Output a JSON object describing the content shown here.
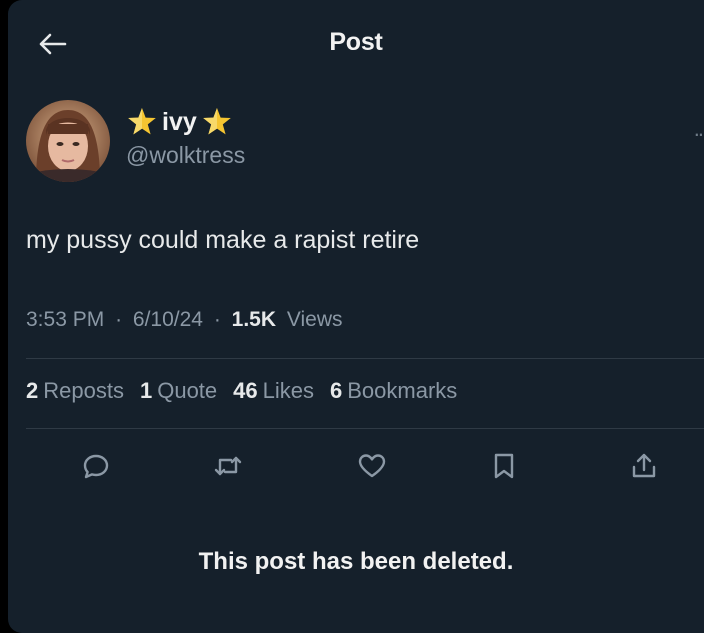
{
  "header": {
    "title": "Post",
    "back_icon": "arrow-left-icon"
  },
  "author": {
    "display_name": "ivy",
    "handle": "@wolktress",
    "name_icons": [
      "star-icon",
      "star-icon"
    ],
    "more_glyph": ".."
  },
  "post": {
    "text": "my pussy could make a rapist retire",
    "time": "3:53 PM",
    "date": "6/10/24",
    "separator": "·",
    "views_count": "1.5K",
    "views_label": "Views"
  },
  "stats": [
    {
      "count": "2",
      "label": "Reposts"
    },
    {
      "count": "1",
      "label": "Quote"
    },
    {
      "count": "46",
      "label": "Likes"
    },
    {
      "count": "6",
      "label": "Bookmarks"
    }
  ],
  "actions": [
    {
      "name": "reply",
      "icon": "reply-icon"
    },
    {
      "name": "repost",
      "icon": "repost-icon"
    },
    {
      "name": "like",
      "icon": "heart-icon"
    },
    {
      "name": "bookmark",
      "icon": "bookmark-icon"
    },
    {
      "name": "share",
      "icon": "share-icon"
    }
  ],
  "notice": "This post has been deleted.",
  "colors": {
    "background": "#15202b",
    "text_primary": "#e7e9ea",
    "text_secondary": "#8b98a5",
    "divider": "#2f3a45",
    "star": "#f5c531"
  }
}
